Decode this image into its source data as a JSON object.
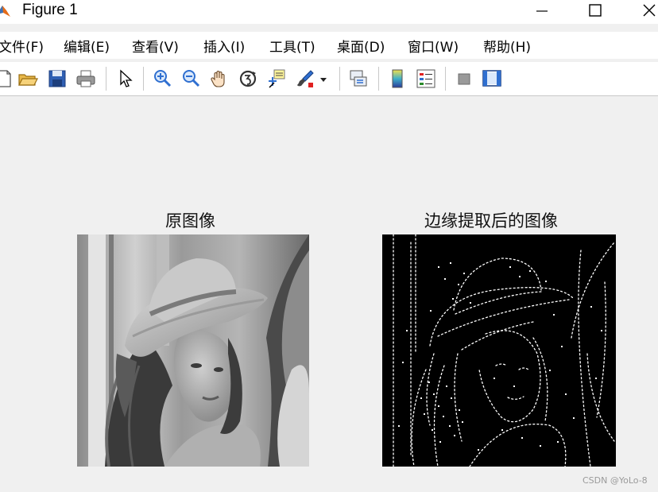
{
  "window": {
    "title": "Figure 1"
  },
  "menu": [
    {
      "label": "文件(F)"
    },
    {
      "label": "编辑(E)"
    },
    {
      "label": "查看(V)"
    },
    {
      "label": "插入(I)"
    },
    {
      "label": "工具(T)"
    },
    {
      "label": "桌面(D)"
    },
    {
      "label": "窗口(W)"
    },
    {
      "label": "帮助(H)"
    }
  ],
  "toolbar": [
    "new-figure-icon",
    "open-file-icon",
    "save-icon",
    "print-icon",
    "pointer-icon",
    "zoom-in-icon",
    "zoom-out-icon",
    "pan-hand-icon",
    "rotate-3d-icon",
    "data-cursor-icon",
    "brush-icon",
    "chevron-down-icon",
    "link-plot-icon",
    "insert-colorbar-icon",
    "insert-legend-icon",
    "hide-plot-tools-icon",
    "show-plot-tools-icon"
  ],
  "axes": [
    {
      "title": "原图像"
    },
    {
      "title": "边缘提取后的图像"
    }
  ],
  "watermark": "CSDN @YoLo-8",
  "colors": {
    "matlab_orange": "#e46c1a",
    "toolbar_blue": "#2f6fd0",
    "figure_bg": "#f0f0f0"
  }
}
